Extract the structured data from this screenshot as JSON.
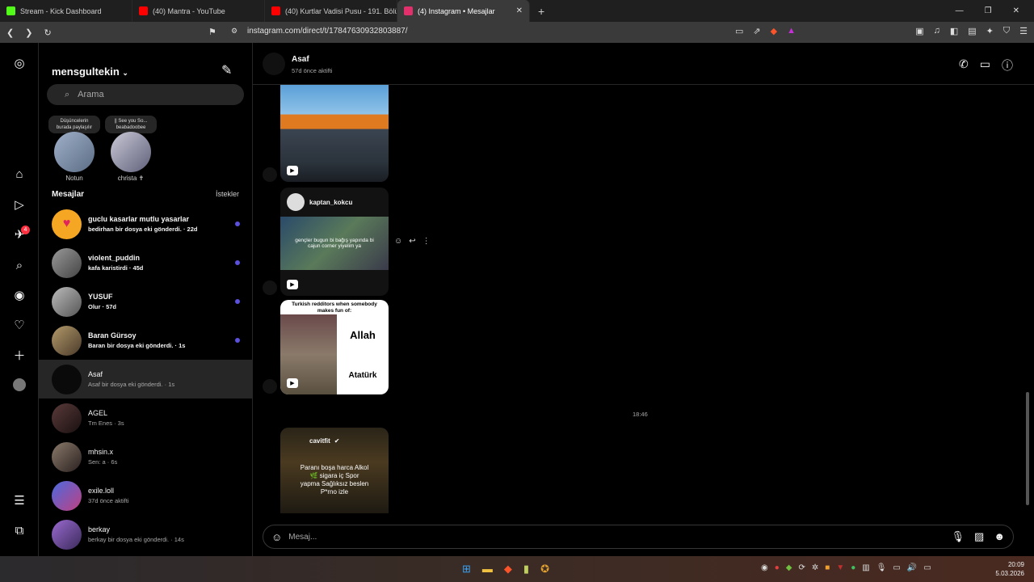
{
  "browser": {
    "tabs": [
      {
        "title": "Stream - Kick Dashboard",
        "color": "#53fc18"
      },
      {
        "title": "(40) Mantra - YouTube",
        "color": "#ff0000"
      },
      {
        "title": "(40) Kurtlar Vadisi Pusu - 191. Bölüm",
        "color": "#ff0000"
      },
      {
        "title": "(4) Instagram • Mesajlar",
        "color": "#e1306c"
      }
    ],
    "url": "instagram.com/direct/t/17847630932803887/"
  },
  "rail": {
    "notification_count": "4"
  },
  "inbox": {
    "username": "mensgultekin",
    "search_placeholder": "Arama",
    "notes": [
      {
        "bubble": "Düşüncelerin burada paylaşılır",
        "name": "Notun"
      },
      {
        "bubble": "|| See you So... beabadoobee",
        "name": "christa ✝"
      }
    ],
    "messages_heading": "Mesajlar",
    "requests_label": "İstekler",
    "conversations": [
      {
        "name": "guclu kasarlar mutlu yasarlar",
        "preview": "bedirhan bir dosya eki gönderdi. · 22d",
        "unread": true,
        "avatar": "#f5a623"
      },
      {
        "name": "violent_puddin",
        "preview": "kafa karistirdi · 45d",
        "unread": true,
        "avatar": "#6b6b6b"
      },
      {
        "name": "YUSUF",
        "preview": "Olur · 57d",
        "unread": true,
        "avatar": "#8a8a8a"
      },
      {
        "name": "Baran Gürsoy",
        "preview": "Baran bir dosya eki gönderdi. · 1s",
        "unread": true,
        "avatar": "#7a6a4a"
      },
      {
        "name": "Asaf",
        "preview": "Asaf bir dosya eki gönderdi. · 1s",
        "unread": false,
        "avatar": "#0a0a0a"
      },
      {
        "name": "AGEL",
        "preview": "Tm Enes · 3s",
        "unread": false,
        "avatar": "#3a2a2a"
      },
      {
        "name": "mhsin.x",
        "preview": "Sen: a · 6s",
        "unread": false,
        "avatar": "#5a4a3a"
      },
      {
        "name": "exile.loll",
        "preview": "37d önce aktifti",
        "unread": false,
        "avatar": "#3a4aa0"
      },
      {
        "name": "berkay",
        "preview": "berkay bir dosya eki gönderdi. · 14s",
        "unread": false,
        "avatar": "#6a4a8a"
      }
    ]
  },
  "chat": {
    "name": "Asaf",
    "status": "57d önce aktifti",
    "reel2": {
      "author": "kaptan_kokcu",
      "caption": "gençler bugun bi bağış yapında bi cajun corner yiyelim ya"
    },
    "reel3": {
      "top": "Turkish redditors when somebody makes fun of:",
      "word1": "Allah",
      "word2": "Atatürk"
    },
    "timestamp": "18:46",
    "reel4": {
      "author": "cavitfit",
      "caption": "Paranı boşa harca Alkol 🌿 sigara iç Spor yapma Sağlıksız beslen P*rno izle"
    },
    "composer_placeholder": "Mesaj..."
  },
  "taskbar": {
    "time": "20:09",
    "date": "5.03.2026"
  }
}
